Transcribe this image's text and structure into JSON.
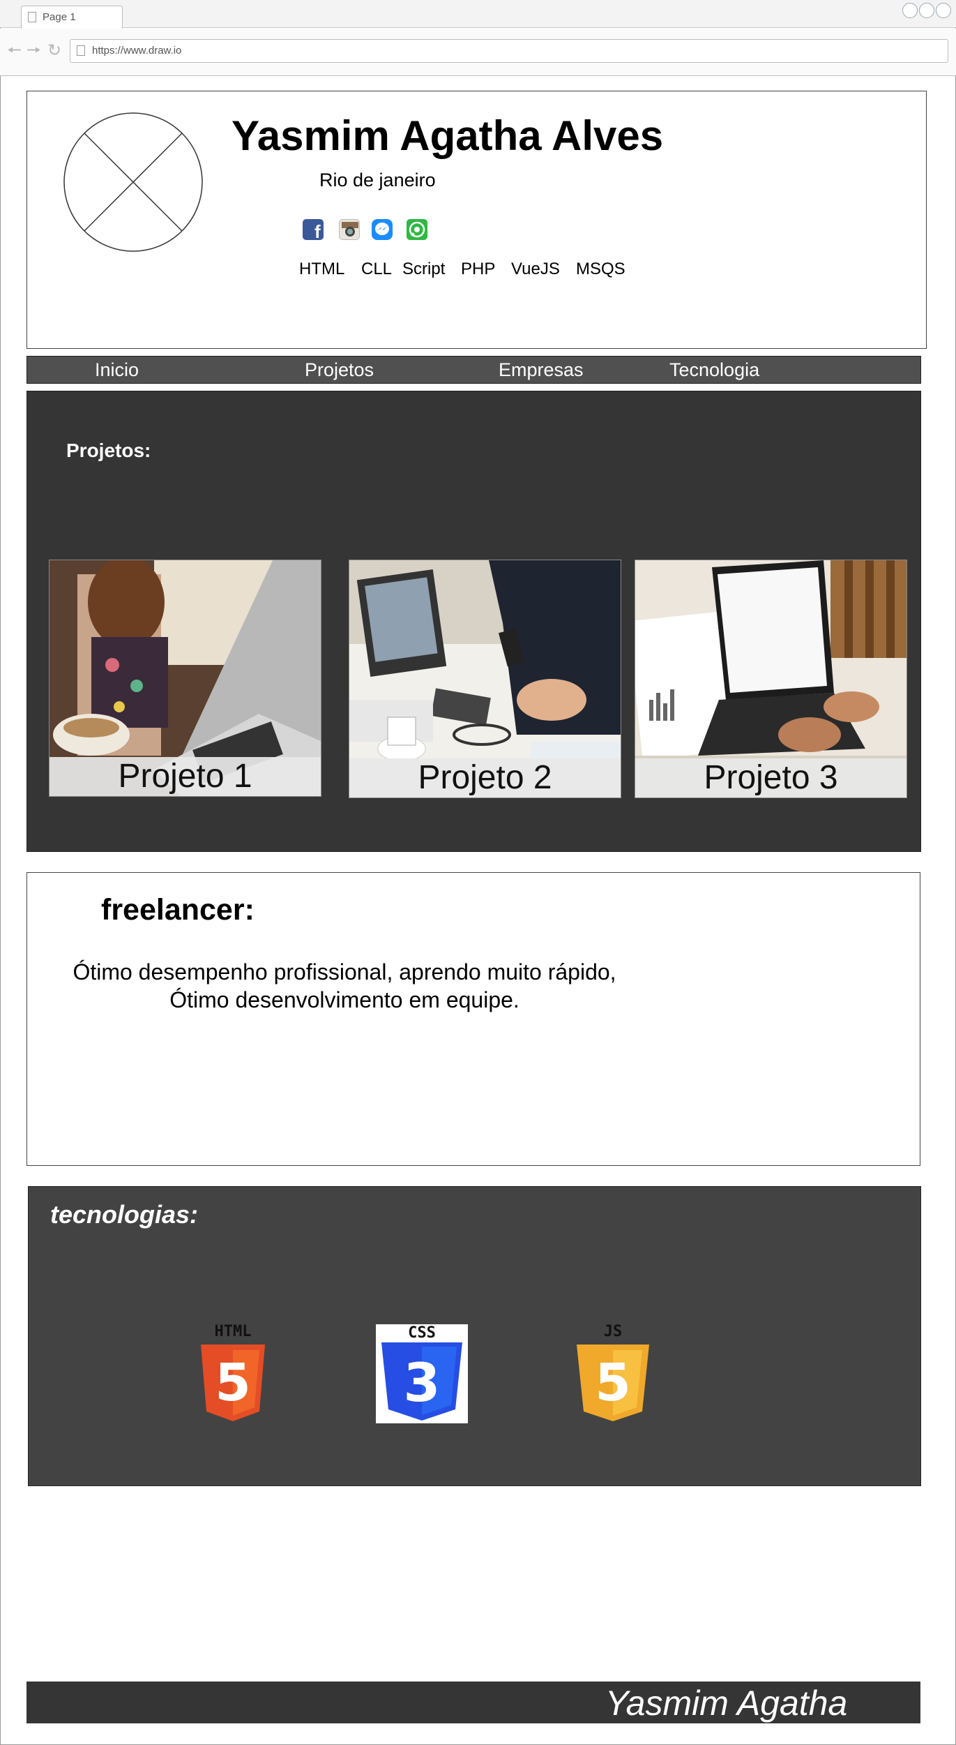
{
  "browser": {
    "tab_label": "Page 1",
    "url": "https://www.draw.io"
  },
  "profile": {
    "name": "Yasmim Agatha Alves",
    "city": "Rio de janeiro",
    "social_icons": [
      "facebook-icon",
      "instagram-icon",
      "messenger-icon",
      "whatsapp-icon"
    ],
    "skills": [
      "HTML",
      "CLL",
      "Script",
      "PHP",
      "VueJS",
      "MSQS"
    ]
  },
  "nav": {
    "items": [
      "Inicio",
      "Projetos",
      "Empresas",
      "Tecnologia"
    ]
  },
  "projects": {
    "title": "Projetos:",
    "cards": [
      {
        "label": "Projeto 1"
      },
      {
        "label": "Projeto 2"
      },
      {
        "label": "Projeto 3"
      }
    ]
  },
  "freelancer": {
    "title": "freelancer:",
    "line1": "Ótimo desempenho profissional, aprendo muito rápido,",
    "line2": "Ótimo desenvolvimento em equipe."
  },
  "technologies": {
    "title": "tecnologias:",
    "logos": [
      {
        "name": "html5-logo",
        "label": "HTML",
        "digit": "5",
        "color": "#e44d26"
      },
      {
        "name": "css3-logo",
        "label": "CSS",
        "digit": "3",
        "color": "#264de4"
      },
      {
        "name": "js-logo",
        "label": "JS",
        "digit": "5",
        "color": "#f0a92a"
      }
    ]
  },
  "footer": {
    "name": "Yasmim Agatha"
  },
  "colors": {
    "panel_dark": "#353535",
    "nav_bg": "#505050",
    "tech_bg": "#434343"
  }
}
